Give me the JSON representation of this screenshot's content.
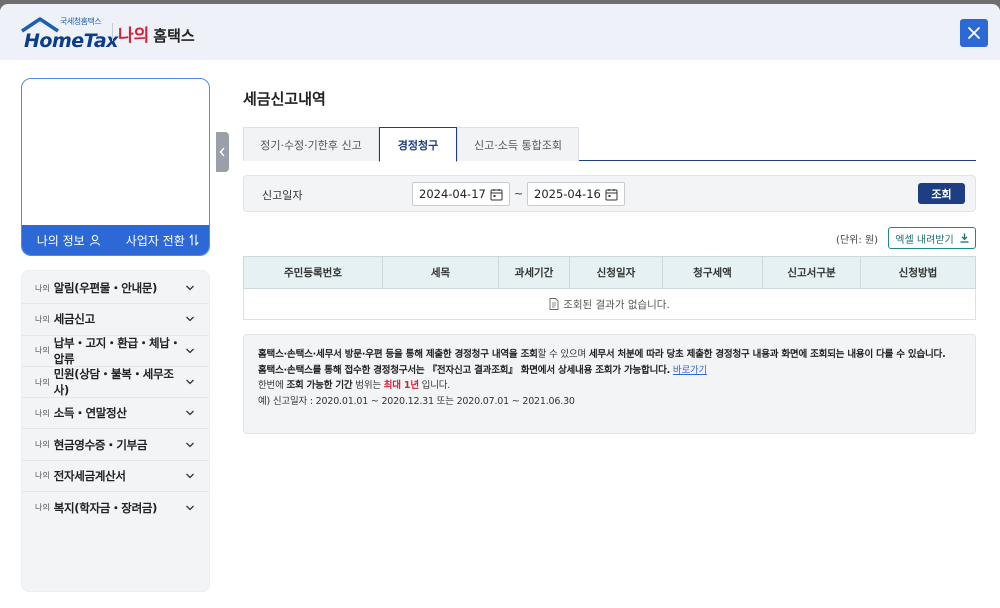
{
  "header": {
    "logo_small": "국세청홈택스",
    "logo_main": "HomeTax",
    "title_red": "나의",
    "title_black": "홈택스"
  },
  "sidebar": {
    "profile_info_label": "나의 정보",
    "business_switch_label": "사업자 전환",
    "menu_prefix": "나의",
    "menu_items": [
      {
        "label": "알림(우편물・안내문)"
      },
      {
        "label": "세금신고"
      },
      {
        "label": "납부・고지・환급・체납・압류"
      },
      {
        "label": "민원(상담・불복・세무조사)"
      },
      {
        "label": "소득・연말정산"
      },
      {
        "label": "현금영수증・기부금"
      },
      {
        "label": "전자세금계산서"
      },
      {
        "label": "복지(학자금・장려금)"
      }
    ]
  },
  "main": {
    "title": "세금신고내역",
    "tabs": [
      {
        "label": "정기·수정·기한후 신고"
      },
      {
        "label": "경정청구"
      },
      {
        "label": "신고·소득 통합조회"
      }
    ],
    "search": {
      "label": "신고일자",
      "date_from": "2024-04-17",
      "tilde": "~",
      "date_to": "2025-04-16",
      "button": "조회"
    },
    "unit": "(단위: 원)",
    "excel_button": "엑셀 내려받기",
    "table": {
      "headers": [
        "주민등록번호",
        "세목",
        "과세기간",
        "신청일자",
        "청구세액",
        "신고서구분",
        "신청방법"
      ],
      "empty_message": "조회된 결과가 없습니다."
    },
    "notice": {
      "l1a": "홈택스·손택스·세무서 방문·우편 등을 통해 제출한 ",
      "l1b": "경정청구 내역을 조회",
      "l1c": "할 수 있으며 ",
      "l1d": "세무서 처분에 따라 당초 제출한 경정청구 내용과 화면에 조회되는 내용이 다를 수 있습니다.",
      "l2a": "홈택스·손택스를 통해 접수한 경정청구서는 ",
      "l2b": "『전자신고 결과조회』",
      "l2c": " 화면에서 상세내용 조회가 가능합니다.",
      "l2link": "바로가기",
      "l3a": "한번에 ",
      "l3b": "조회 가능한 기간",
      "l3c": " 범위는 ",
      "l3d": "최대 1년",
      "l3e": " 입니다.",
      "l4": "예) 신고일자 : 2020.01.01 ~ 2020.12.31 또는 2020.07.01 ~ 2021.06.30"
    }
  },
  "colors": {
    "primary": "#2d69d6",
    "navy": "#1d3e82",
    "red": "#d62038",
    "teal": "#1a8a8a"
  }
}
